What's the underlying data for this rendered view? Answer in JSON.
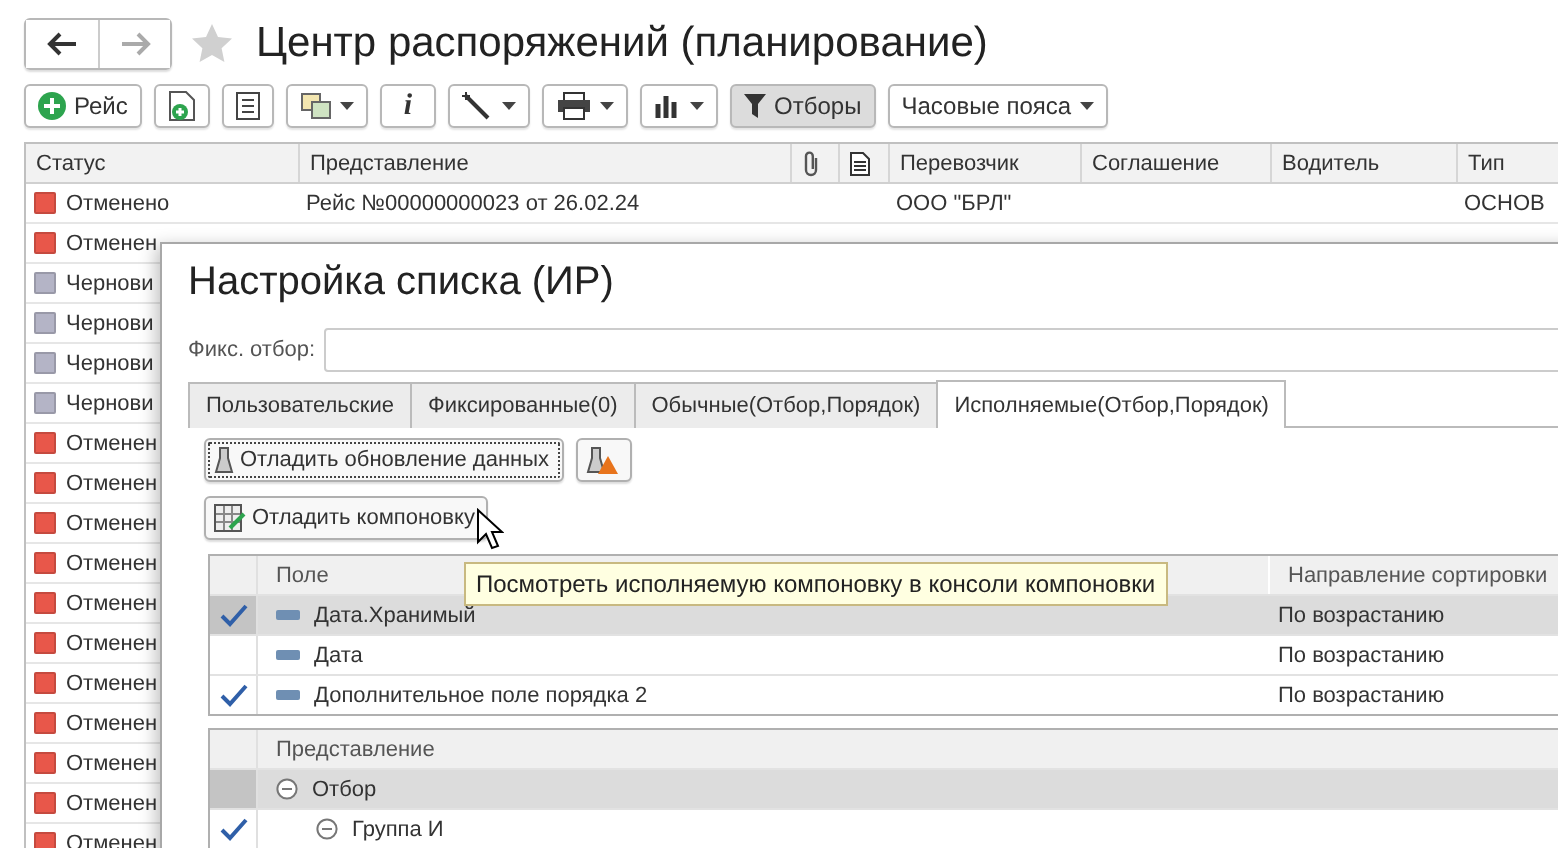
{
  "window": {
    "title": "Центр распоряжений (планирование)"
  },
  "nav": [
    {
      "kind": "back",
      "disabled": false
    },
    {
      "kind": "forward",
      "disabled": true
    }
  ],
  "toolbar": [
    {
      "kind": "add",
      "label": "Рейс",
      "dropdown": false,
      "pressed": false
    },
    {
      "kind": "doc-add",
      "dropdown": false,
      "pressed": false
    },
    {
      "kind": "list",
      "dropdown": false,
      "pressed": false
    },
    {
      "kind": "copy",
      "dropdown": true,
      "pressed": false
    },
    {
      "kind": "info",
      "glyph": "i",
      "dropdown": false,
      "pressed": false
    },
    {
      "kind": "wand",
      "dropdown": true,
      "pressed": false
    },
    {
      "kind": "print",
      "dropdown": true,
      "pressed": false
    },
    {
      "kind": "chart",
      "dropdown": true,
      "pressed": false
    },
    {
      "kind": "filter",
      "label": "Отборы",
      "dropdown": false,
      "pressed": true
    },
    {
      "kind": "text",
      "label": "Часовые пояса",
      "dropdown": true,
      "pressed": false
    }
  ],
  "list": {
    "columns": [
      {
        "kind": "text",
        "label": "Статус"
      },
      {
        "kind": "text",
        "label": "Представление"
      },
      {
        "kind": "attachment"
      },
      {
        "kind": "note"
      },
      {
        "kind": "text",
        "label": "Перевозчик"
      },
      {
        "kind": "text",
        "label": "Соглашение"
      },
      {
        "kind": "text",
        "label": "Водитель"
      },
      {
        "kind": "text",
        "label": "Тип"
      }
    ],
    "rows": [
      {
        "status": "Отменено",
        "color": "#e8574a",
        "presentation": "Рейс №00000000023 от 26.02.24",
        "carrier": "ООО \"БРЛ\"",
        "type": "ОСНОВ"
      },
      {
        "status": "Отменен",
        "color": "#e8574a"
      },
      {
        "status": "Чернови",
        "color": "#b4b4c6"
      },
      {
        "status": "Чернови",
        "color": "#b4b4c6"
      },
      {
        "status": "Чернови",
        "color": "#b4b4c6"
      },
      {
        "status": "Чернови",
        "color": "#b4b4c6"
      },
      {
        "status": "Отменен",
        "color": "#e8574a"
      },
      {
        "status": "Отменен",
        "color": "#e8574a"
      },
      {
        "status": "Отменен",
        "color": "#e8574a"
      },
      {
        "status": "Отменен",
        "color": "#e8574a"
      },
      {
        "status": "Отменен",
        "color": "#e8574a"
      },
      {
        "status": "Отменен",
        "color": "#e8574a"
      },
      {
        "status": "Отменен",
        "color": "#e8574a"
      },
      {
        "status": "Отменен",
        "color": "#e8574a"
      },
      {
        "status": "Отменен",
        "color": "#e8574a"
      },
      {
        "status": "Отменен",
        "color": "#e8574a"
      },
      {
        "status": "Отменен",
        "color": "#e8574a"
      }
    ]
  },
  "dialog": {
    "title": "Настройка списка (ИР)",
    "fixed_filter": {
      "label": "Фикс. отбор:"
    },
    "tabs": [
      {
        "label": "Пользовательские",
        "selected": false
      },
      {
        "label": "Фиксированные(0)",
        "selected": false
      },
      {
        "label": "Обычные(Отбор,Порядок)",
        "selected": false
      },
      {
        "label": "Исполняемые(Отбор,Порядок)",
        "selected": true
      }
    ],
    "debug_update": {
      "label": "Отладить обновление данных",
      "focused": true
    },
    "debug_layout": {
      "label": "Отладить компоновку"
    },
    "order_table": {
      "columns": [
        "Поле",
        "Направление сортировки"
      ],
      "rows": [
        {
          "checked": true,
          "selected": true,
          "field": "Дата.Хранимый",
          "direction": "По возрастанию"
        },
        {
          "checked": false,
          "selected": false,
          "field": "Дата",
          "direction": "По возрастанию"
        },
        {
          "checked": true,
          "selected": false,
          "field": "Дополнительное поле порядка 2",
          "direction": "По возрастанию"
        }
      ]
    },
    "filter_table": {
      "columns": [
        "Представление"
      ],
      "rows": [
        {
          "label": "Отбор",
          "checked": false,
          "selected": true,
          "children": [
            {
              "label": "Группа И",
              "checked": true,
              "selected": false
            }
          ]
        }
      ]
    },
    "tooltip": "Посмотреть исполняемую компоновку в консоли компоновки"
  }
}
